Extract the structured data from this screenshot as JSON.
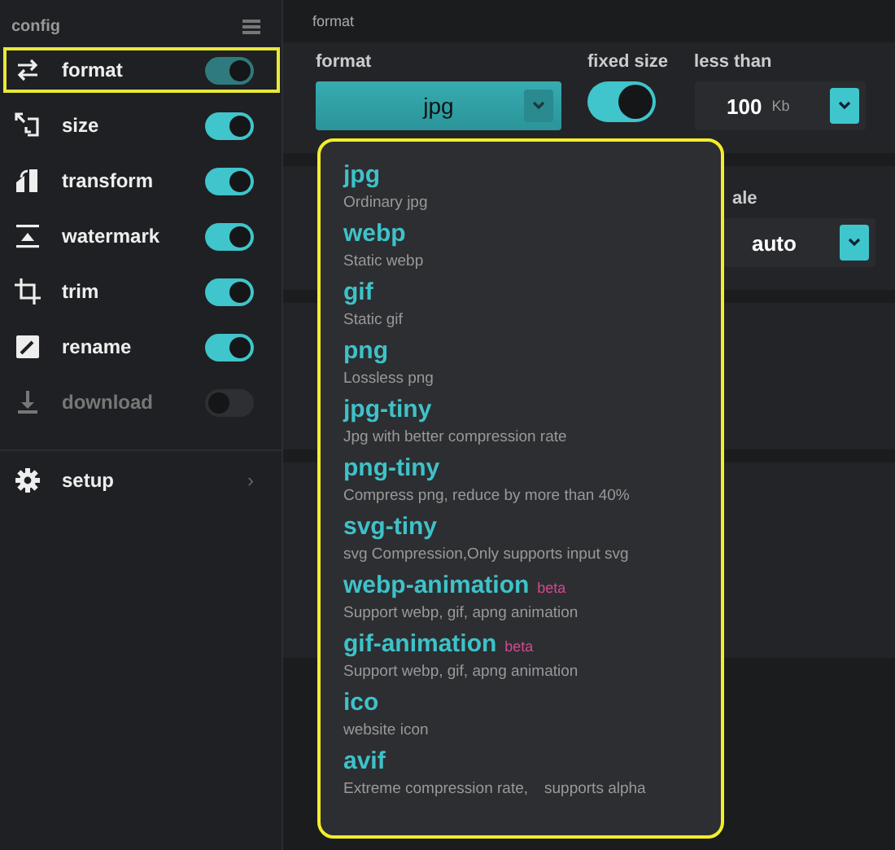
{
  "sidebar": {
    "title": "config",
    "items": [
      {
        "label": "format",
        "on": true,
        "selected": true
      },
      {
        "label": "size",
        "on": true,
        "selected": false
      },
      {
        "label": "transform",
        "on": true,
        "selected": false
      },
      {
        "label": "watermark",
        "on": true,
        "selected": false
      },
      {
        "label": "trim",
        "on": true,
        "selected": false
      },
      {
        "label": "rename",
        "on": true,
        "selected": false
      },
      {
        "label": "download",
        "on": false,
        "selected": false
      }
    ],
    "setup": {
      "label": "setup",
      "arrow": "›"
    }
  },
  "section_title": "format",
  "format_panel": {
    "format": {
      "label": "format",
      "value": "jpg"
    },
    "fixed_size": {
      "label": "fixed size",
      "on": true
    },
    "less_than": {
      "label": "less than",
      "value": "100",
      "unit": "Kb"
    }
  },
  "scale_panel": {
    "label": "ale",
    "value": "auto"
  },
  "dropdown": [
    {
      "name": "jpg",
      "description": "Ordinary jpg"
    },
    {
      "name": "webp",
      "description": "Static webp"
    },
    {
      "name": "gif",
      "description": "Static gif"
    },
    {
      "name": "png",
      "description": "Lossless png"
    },
    {
      "name": "jpg-tiny",
      "description": "Jpg with better compression rate"
    },
    {
      "name": "png-tiny",
      "description": "Compress png, reduce by more than 40%"
    },
    {
      "name": "svg-tiny",
      "description": "svg Compression,Only supports input svg"
    },
    {
      "name": "webp-animation",
      "badge": "beta",
      "description": "Support webp, gif, apng animation"
    },
    {
      "name": "gif-animation",
      "badge": "beta",
      "description": "Support webp, gif, apng animation"
    },
    {
      "name": "ico",
      "description": "website icon"
    },
    {
      "name": "avif",
      "description": "Extreme compression rate,　supports alpha"
    }
  ]
}
